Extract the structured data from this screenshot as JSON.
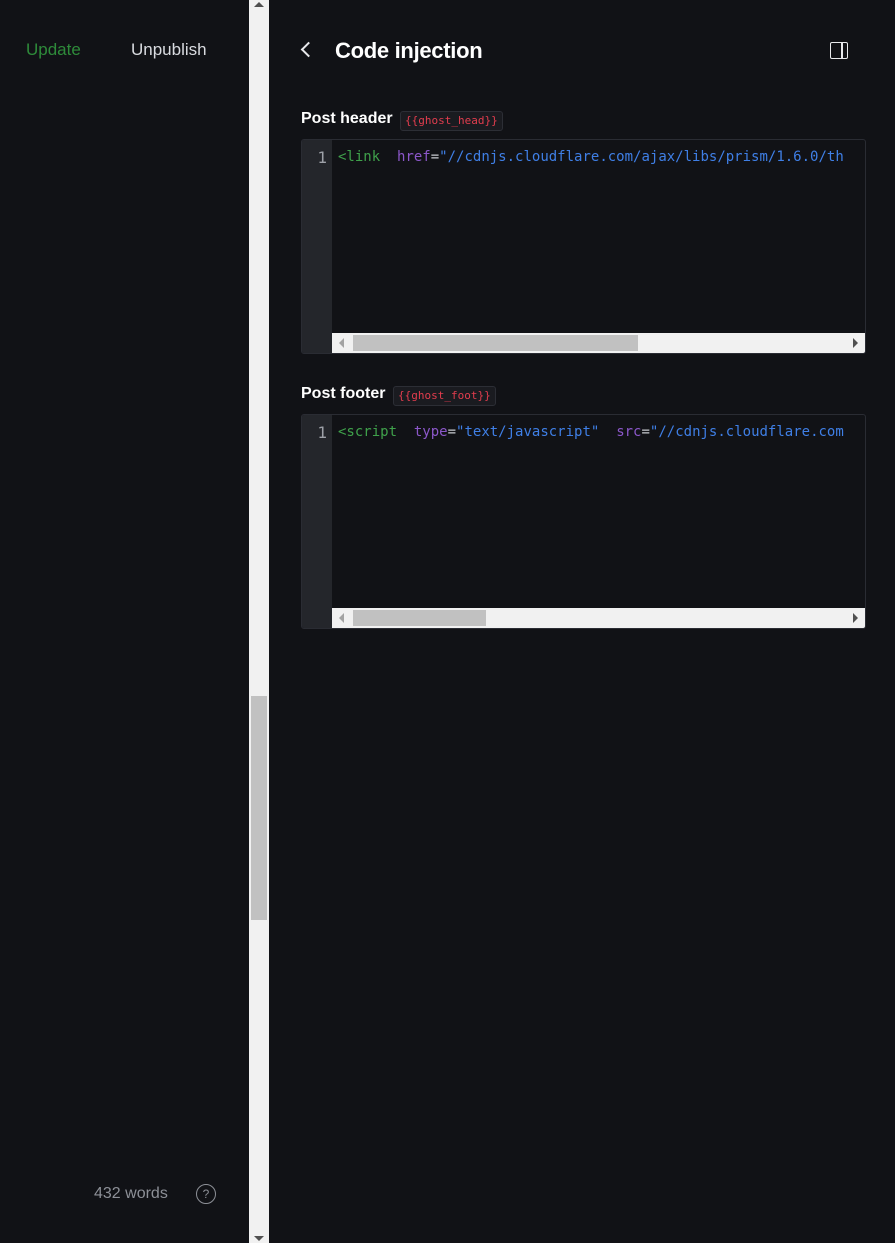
{
  "editor_sidebar": {
    "update_label": "Update",
    "unpublish_label": "Unpublish",
    "word_count": "432 words",
    "help_glyph": "?"
  },
  "panel": {
    "title": "Code injection",
    "back_icon": "chevron-left-icon",
    "toggle_icon": "sidebar-toggle-icon"
  },
  "header_section": {
    "label": "Post header",
    "helper": "{{ghost_head}}",
    "line_number": "1",
    "code": [
      {
        "type": "tag",
        "text": "<link"
      },
      {
        "type": "punct",
        "text": "  "
      },
      {
        "type": "attr",
        "text": "href"
      },
      {
        "type": "punct",
        "text": "="
      },
      {
        "type": "string",
        "text": "\"//cdnjs.cloudflare.com/ajax/libs/prism/1.6.0/th"
      }
    ],
    "scroll_position": 0.0,
    "scroll_visible_fraction": 0.58
  },
  "footer_section": {
    "label": "Post footer",
    "helper": "{{ghost_foot}}",
    "line_number": "1",
    "code": [
      {
        "type": "tag",
        "text": "<script"
      },
      {
        "type": "punct",
        "text": "  "
      },
      {
        "type": "attr",
        "text": "type"
      },
      {
        "type": "punct",
        "text": "="
      },
      {
        "type": "string",
        "text": "\"text/javascript\""
      },
      {
        "type": "punct",
        "text": "  "
      },
      {
        "type": "attr",
        "text": "src"
      },
      {
        "type": "punct",
        "text": "="
      },
      {
        "type": "string",
        "text": "\"//cdnjs.cloudflare.com"
      }
    ],
    "scroll_position": 0.0,
    "scroll_visible_fraction": 0.27
  },
  "colors": {
    "background": "#111216",
    "accent_green": "#2e8b3a",
    "helper_red": "#e23d4e",
    "code_tag": "#3fa14b",
    "code_attr": "#8b57c9",
    "code_string": "#3f7fe6"
  }
}
